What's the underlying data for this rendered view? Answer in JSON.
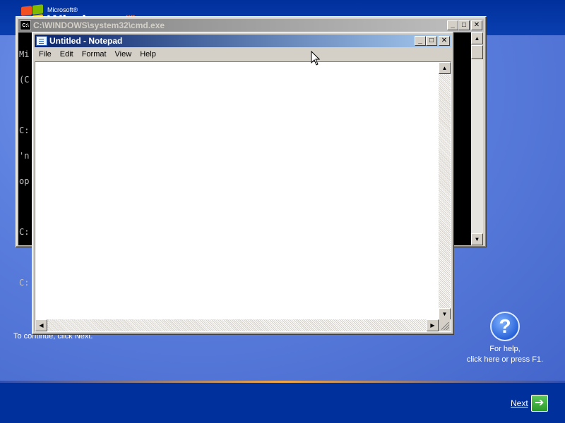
{
  "background": {
    "logo": {
      "microsoft": "Microsoft®",
      "windows": "Windows",
      "xp": "xp"
    },
    "continue_text": "To continue, click Next.",
    "help": {
      "icon": "question-icon",
      "glyph": "?",
      "line1": "For help,",
      "line2": "click here or press F1."
    },
    "next": {
      "label": "Next",
      "icon": "arrow-right-icon",
      "glyph": "➔"
    },
    "colors": {
      "band": "#00309c",
      "main": "#5a7edc",
      "accent_line": "#f2a544",
      "next_green": "#2b9a2a"
    }
  },
  "cmd_window": {
    "title": "C:\\WINDOWS\\system32\\cmd.exe",
    "icon_text": "C:\\",
    "buttons": {
      "minimize": "_",
      "maximize": "□",
      "close": "✕"
    },
    "console_lines": [
      "Mi",
      "(C",
      "",
      "C:",
      "'n",
      "op",
      "",
      "C:",
      "",
      "C:"
    ],
    "scroll": {
      "up": "▲",
      "down": "▼"
    }
  },
  "notepad": {
    "title": "Untitled - Notepad",
    "buttons": {
      "minimize": "_",
      "maximize": "□",
      "close": "✕"
    },
    "menu": [
      "File",
      "Edit",
      "Format",
      "View",
      "Help"
    ],
    "content": "",
    "scroll": {
      "up": "▲",
      "down": "▼",
      "left": "◀",
      "right": "▶"
    }
  }
}
